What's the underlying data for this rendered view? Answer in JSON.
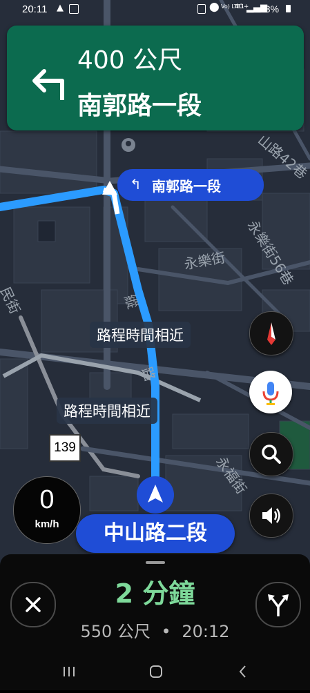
{
  "status_bar": {
    "time": "20:11",
    "battery": "93%",
    "network": "4G+",
    "volte": "Vo) LTE1"
  },
  "banner": {
    "distance": "400 公尺",
    "street": "南郭路一段",
    "color": "#0c6b4f",
    "turn_icon": "turn-left-arrow-icon"
  },
  "map": {
    "turn_callout": "南郭路一段",
    "alt_route_label_1": "路程時間相近",
    "alt_route_label_2": "路程時間相近",
    "route_shield": "139",
    "street_labels": [
      "山路42巷",
      "永樂街56巷",
      "永樂街",
      "永福街",
      "民街",
      "縱",
      "路"
    ],
    "route_color": "#2b9bff"
  },
  "speedometer": {
    "value": "0",
    "unit": "km/h"
  },
  "current_street": "中山路二段",
  "buttons": {
    "compass": "compass-icon",
    "voice": "mic-icon",
    "search": "search-icon",
    "sound": "speaker-icon"
  },
  "trip": {
    "eta_duration": "2 分鐘",
    "distance": "550 公尺",
    "separator": "•",
    "arrival_time": "20:12"
  }
}
